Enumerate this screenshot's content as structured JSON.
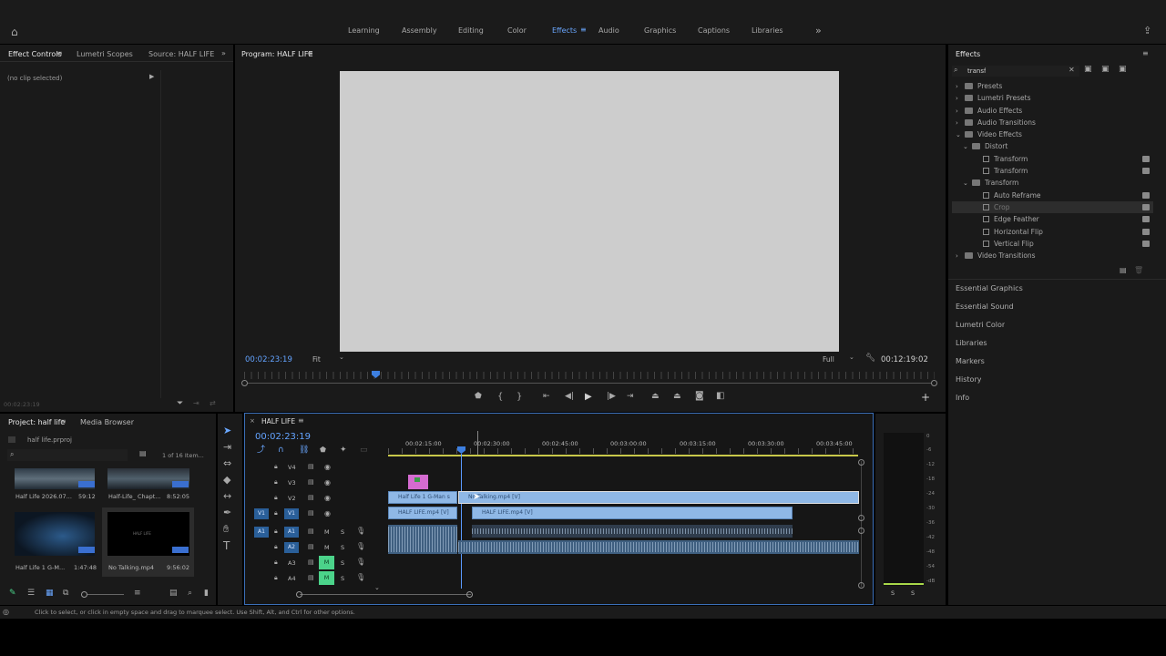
{
  "workspace_tabs": [
    "Learning",
    "Assembly",
    "Editing",
    "Color",
    "Effects",
    "Audio",
    "Graphics",
    "Captions",
    "Libraries"
  ],
  "active_workspace": "Effects",
  "left_panel": {
    "tabs": [
      "Effect Controls",
      "Lumetri Scopes",
      "Source: HALF LIFE"
    ],
    "no_clip": "(no clip selected)",
    "timecode": "00:02:23:19"
  },
  "program": {
    "title": "Program: HALF LIFE",
    "timecode": "00:02:23:19",
    "fit": "Fit",
    "quality": "Full",
    "duration": "00:12:19:02"
  },
  "project": {
    "tabs": [
      "Project: half life",
      "Media Browser"
    ],
    "file": "half life.prproj",
    "count": "1 of 16 Item...",
    "items": [
      {
        "name": "Half Life 2026.07...",
        "dur": "59:12"
      },
      {
        "name": "Half-Life_ Chapt...",
        "dur": "8:52:05"
      },
      {
        "name": "Half Life 1 G-M...",
        "dur": "1:47:48"
      },
      {
        "name": "No Talking.mp4",
        "dur": "9:56:02"
      }
    ],
    "thumb_text": "HALF LIFE"
  },
  "timeline": {
    "title": "HALF LIFE",
    "timecode": "00:02:23:19",
    "ruler": [
      "00:02:15:00",
      "00:02:30:00",
      "00:02:45:00",
      "00:03:00:00",
      "00:03:15:00",
      "00:03:30:00",
      "00:03:45:00"
    ],
    "tracks_v": [
      "V4",
      "V3",
      "V2",
      "V1"
    ],
    "tracks_a": [
      "A1",
      "A2",
      "A3",
      "A4"
    ],
    "src_v": "V1",
    "src_a": "A1",
    "m_label": "M",
    "s_label": "S",
    "clips": {
      "v2_a": "Half Life 1 G-Man s",
      "v2_b": "No Talking.mp4 [V]",
      "v1_a": "HALF LIFE.mp4 [V]",
      "v1_b": "HALF LIFE.mp4 [V]"
    }
  },
  "meter": {
    "scale": [
      "0",
      "-6",
      "-12",
      "-18",
      "-24",
      "-30",
      "-36",
      "-42",
      "-48",
      "-54",
      "-dB"
    ],
    "solo": [
      "S",
      "S"
    ]
  },
  "effects": {
    "title": "Effects",
    "search": "transf",
    "items": [
      {
        "label": "Presets",
        "level": 0,
        "type": "folder"
      },
      {
        "label": "Lumetri Presets",
        "level": 0,
        "type": "folder"
      },
      {
        "label": "Audio Effects",
        "level": 0,
        "type": "folder"
      },
      {
        "label": "Audio Transitions",
        "level": 0,
        "type": "folder"
      },
      {
        "label": "Video Effects",
        "level": 0,
        "type": "folder",
        "open": true
      },
      {
        "label": "Distort",
        "level": 1,
        "type": "folder",
        "open": true
      },
      {
        "label": "Transform",
        "level": 2,
        "type": "fx"
      },
      {
        "label": "Transform",
        "level": 2,
        "type": "fx"
      },
      {
        "label": "Transform",
        "level": 1,
        "type": "folder",
        "open": true
      },
      {
        "label": "Auto Reframe",
        "level": 2,
        "type": "fx"
      },
      {
        "label": "Crop",
        "level": 2,
        "type": "fx",
        "selected": true
      },
      {
        "label": "Edge Feather",
        "level": 2,
        "type": "fx"
      },
      {
        "label": "Horizontal Flip",
        "level": 2,
        "type": "fx"
      },
      {
        "label": "Vertical Flip",
        "level": 2,
        "type": "fx"
      },
      {
        "label": "Video Transitions",
        "level": 0,
        "type": "folder"
      }
    ]
  },
  "side_panels": [
    "Essential Graphics",
    "Essential Sound",
    "Lumetri Color",
    "Libraries",
    "Markers",
    "History",
    "Info"
  ],
  "status": "Click to select, or click in empty space and drag to marquee select. Use Shift, Alt, and Ctrl for other options.",
  "colors": {
    "accent": "#63a3ff",
    "clip_video": "#8fb8e6",
    "clip_audio": "#3f5f80",
    "label_pink": "#d46bd0",
    "mute_green": "#4bd38a"
  }
}
